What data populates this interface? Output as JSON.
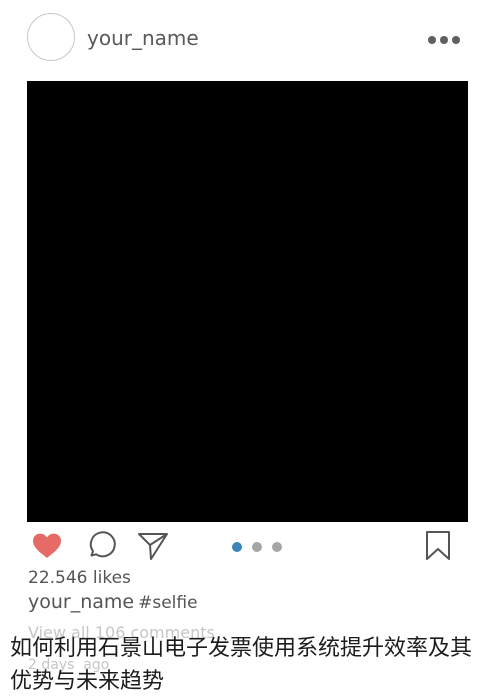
{
  "post": {
    "username": "your_name",
    "likes": "22.546 likes",
    "caption_username": "your_name",
    "caption_hashtag": "#selfie",
    "view_comments": "View all 106 comments",
    "timestamp": "2 days  ago"
  },
  "carousel": {
    "active_index": 0,
    "count": 3,
    "active_color": "#3d84b8",
    "inactive_color": "#a5a5a5"
  },
  "icons": {
    "like": "heart-icon",
    "comment": "comment-icon",
    "share": "send-icon",
    "save": "bookmark-icon",
    "more": "more-icon"
  },
  "colors": {
    "like": "#e66b66"
  },
  "article": {
    "title": "如何利用石景山电子发票使用系统提升效率及其优势与未来趋势"
  }
}
